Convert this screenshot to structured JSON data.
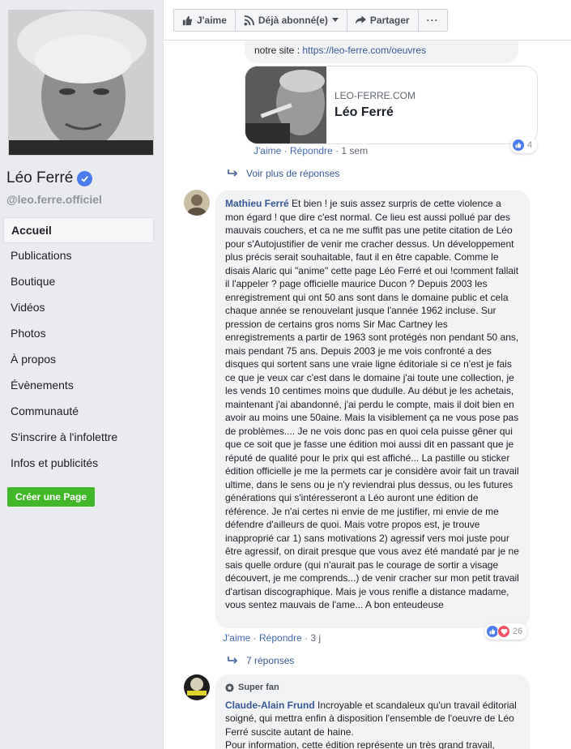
{
  "sidebar": {
    "page_name": "Léo Ferré",
    "username": "@leo.ferre.officiel",
    "nav": [
      "Accueil",
      "Publications",
      "Boutique",
      "Vidéos",
      "Photos",
      "À propos",
      "Évènements",
      "Communauté",
      "S'inscrire à l'infolettre",
      "Infos et publicités"
    ],
    "create_page": "Créer une Page"
  },
  "toolbar": {
    "like": "J'aime",
    "subscribed": "Déjà abonné(e)",
    "share": "Partager",
    "more": "···"
  },
  "comment1": {
    "text_prefix": "notre site : ",
    "url": "https://leo-ferre.com/oeuvres",
    "preview_domain": "LEO-FERRE.COM",
    "preview_title": "Léo Ferré",
    "like": "J'aime",
    "sep": "·",
    "reply": "Répondre",
    "time": "1 sem",
    "reactions": "4"
  },
  "more_replies": "Voir plus de réponses",
  "comment2": {
    "author": "Mathieu Ferré",
    "text": "Et bien ! je suis assez surpris de cette violence a mon égard ! que dire c'est normal. Ce lieu est aussi pollué par des mauvais couchers, et ca ne me suffit pas une petite citation de Léo pour s'Autojustifier de venir me cracher dessus. Un développement plus précis serait souhaitable, faut il en être capable. Comme le disais Alaric qui \"anime\" cette page Léo Ferré et oui !comment fallait il l'appeler ? page officielle maurice Ducon ? Depuis 2003 les enregistrement qui ont 50 ans sont dans le domaine public et cela chaque année se renouvelant jusque l'année 1962 incluse. Sur pression de certains gros noms Sir Mac Cartney les enregistrements a partir de 1963 sont protégés non pendant 50 ans, mais pendant 75 ans. Depuis 2003 je me vois confronté a des disques qui sortent sans une vraie ligne éditoriale si ce n'est je fais ce que je veux car c'est dans le domaine j'ai toute une collection, je les vends 10 centimes moins que dudulle. Au début je les achetais, maintenant j'ai abandonné, j'ai perdu le compte, mais il doit bien en avoir au moins une 50aine. Mais la visiblement ça ne vous pose pas de problèmes.... Je ne vois donc pas en quoi cela puisse gêner qui que ce soit que je fasse une édition moi aussi dit en passant que je réputé de qualité pour le prix qui est affiché... La pastille ou sticker édition officielle je me la permets car je considère avoir fait un travail ultime, dans le sens ou je n'y reviendrai plus dessus, ou les futures générations qui s'intéresseront a Léo auront une édition de référence. Je n'ai certes ni envie de me justifier, mi envie de me défendre d'ailleurs de quoi. Mais votre propos est, je trouve inapproprié car 1) sans motivations 2) agressif vers moi juste pour être agressif, on dirait presque que vous avez été mandaté par je ne sais quelle ordure (qui n'aurait pas le courage de sortir a visage découvert, je me comprends...) de venir cracher sur mon petit travail d'artisan discographique. Mais je vous renifle a distance madame, vous sentez mauvais de l'ame... A bon enteudeuse",
    "like": "J'aime",
    "sep": "·",
    "reply": "Répondre",
    "time": "3 j",
    "reactions": "26",
    "replies_link": "7 réponses"
  },
  "comment3": {
    "badge": "Super fan",
    "author": "Claude-Alain Frund",
    "text": "Incroyable et scandaleux qu'un travail éditorial soigné, qui mettra enfin à disposition l'ensemble de l'oeuvre de Léo Ferré suscite autant de haine.",
    "text2": "Pour information, cette édition représente un très grand travail,"
  },
  "colors": {
    "link": "#385898",
    "accent": "#4b7bec",
    "green": "#42b72a",
    "bubble": "#f2f3f5"
  }
}
